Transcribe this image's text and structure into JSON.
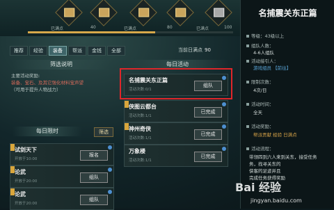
{
  "rewards": {
    "ticks": [
      "已满点",
      "40",
      "已满点",
      "80",
      "已满点",
      "100"
    ],
    "progress_fraction": 0.62
  },
  "tabs": [
    {
      "label": "推荐"
    },
    {
      "label": "经验"
    },
    {
      "label": "装备"
    },
    {
      "label": "帮派"
    },
    {
      "label": "金钱"
    },
    {
      "label": "全部"
    }
  ],
  "points": {
    "label": "当前日满点",
    "value": "90"
  },
  "left": {
    "filter_title": "筛选说明",
    "desc_line1": "主要活动奖励:",
    "desc_line2": "装备、宝石、及其它强化材料宝声望",
    "desc_line3": "（可用于提升人物战力）",
    "daily_limit_title": "每日限时",
    "filter_btn": "筛选"
  },
  "middle": {
    "daily_title": "每日活动"
  },
  "daily_cards": [
    {
      "title": "名捕震关东正篇",
      "sub": "活动次数:0/1",
      "button": "组队"
    },
    {
      "title": "侠图云都台",
      "sub": "活动次数:1/1",
      "button": "已完成"
    },
    {
      "title": "神州奇侠",
      "sub": "活动次数:1/1",
      "button": "已完成"
    },
    {
      "title": "万象楼",
      "sub": "活动次数:1/1",
      "button": "已完成"
    }
  ],
  "limit_cards": [
    {
      "title": "试剑天下",
      "sub": "开放于10:00",
      "button": "报名"
    },
    {
      "title": "论武",
      "sub": "开放于20:00",
      "button": "组队"
    },
    {
      "title": "论武",
      "sub": "开放于20:00",
      "button": "组队"
    }
  ],
  "detail": {
    "title": "名捕震关东正篇",
    "level_label": "等级：",
    "level_value": "43级以上",
    "team_label": "组队人数：",
    "team_value": "4-6人组队",
    "npc_label": "活动接引人：",
    "npc_value": "游戏组员 【前往】",
    "count_label": "限制次数：",
    "count_value": "4次/日",
    "time_label": "活动时间：",
    "time_value": "全天",
    "reward_label": "活动奖励：",
    "reward_value": "帮派贡献 经验 日满点",
    "flow_label": "活动流程：",
    "flow_line1": "带领四到六人来到关东，接受任务",
    "flow_line2": "务，找寻关东的",
    "flow_line3": "侠客的足迹并且",
    "flow_line4": "完成任务获得奖励"
  },
  "watermark": {
    "logo": "Bai 经验",
    "url": "jingyan.baidu.com"
  },
  "colors": {
    "accent": "#d7a84a",
    "highlight": "#e0262a",
    "link": "#5aa5d8"
  }
}
